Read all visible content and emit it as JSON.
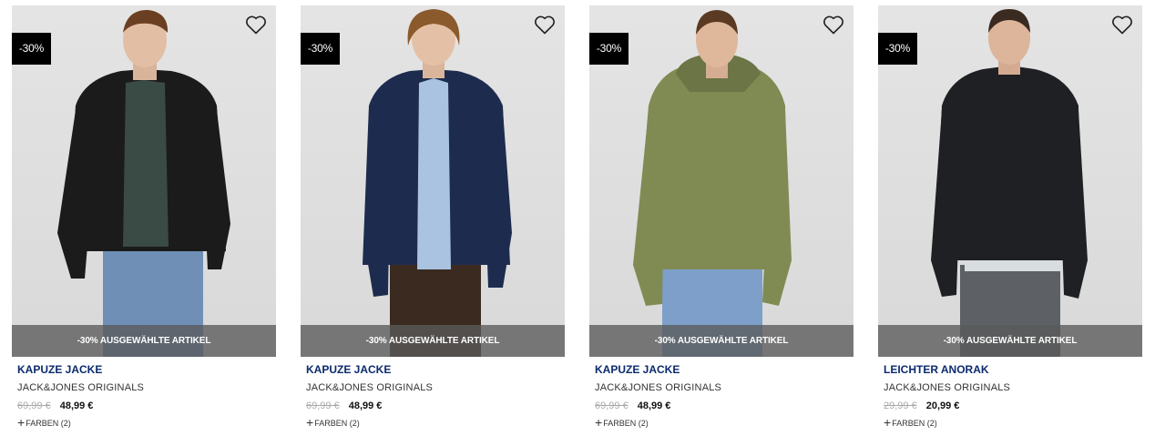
{
  "products": [
    {
      "badge": "-30%",
      "promo": "-30% AUSGEWÄHLTE ARTIKEL",
      "title": "KAPUZE JACKE",
      "brand": "JACK&JONES ORIGINALS",
      "old_price": "69,99 €",
      "new_price": "48,99 €",
      "colors_plus": "+",
      "colors_label": "FARBEN (2)",
      "jacket_color": "#1b1b1b",
      "inner_color": "#3a4a45",
      "pants_color": "#6f8fb7"
    },
    {
      "badge": "-30%",
      "promo": "-30% AUSGEWÄHLTE ARTIKEL",
      "title": "KAPUZE JACKE",
      "brand": "JACK&JONES ORIGINALS",
      "old_price": "69,99 €",
      "new_price": "48,99 €",
      "colors_plus": "+",
      "colors_label": "FARBEN (2)",
      "jacket_color": "#1d2c4e",
      "inner_color": "#a9c3e0",
      "pants_color": "#3b2a20"
    },
    {
      "badge": "-30%",
      "promo": "-30% AUSGEWÄHLTE ARTIKEL",
      "title": "KAPUZE JACKE",
      "brand": "JACK&JONES ORIGINALS",
      "old_price": "69,99 €",
      "new_price": "48,99 €",
      "colors_plus": "+",
      "colors_label": "FARBEN (2)",
      "jacket_color": "#7f8b53",
      "inner_color": "#6b7545",
      "pants_color": "#7d9fc9"
    },
    {
      "badge": "-30%",
      "promo": "-30% AUSGEWÄHLTE ARTIKEL",
      "title": "LEICHTER ANORAK",
      "brand": "JACK&JONES ORIGINALS",
      "old_price": "29,99 €",
      "new_price": "20,99 €",
      "colors_plus": "+",
      "colors_label": "FARBEN (2)",
      "jacket_color": "#1e2024",
      "inner_color": "#d8dde0",
      "pants_color": "#5d6166"
    }
  ]
}
